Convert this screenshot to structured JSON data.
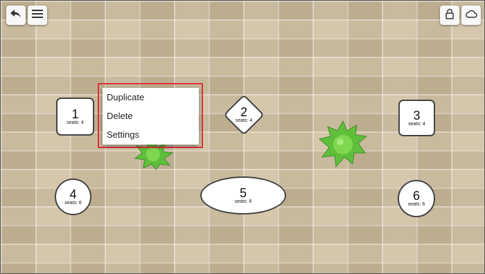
{
  "toolbar": {
    "back_icon": "undo-arrow-icon",
    "menu_icon": "hamburger-menu-icon",
    "lock_icon": "lock-icon",
    "cloud_icon": "cloud-icon"
  },
  "tables": [
    {
      "number": "1",
      "seats": "seats: 4",
      "shape": "rectangle"
    },
    {
      "number": "2",
      "seats": "seats: 4",
      "shape": "diamond"
    },
    {
      "number": "3",
      "seats": "seats: 4",
      "shape": "rectangle"
    },
    {
      "number": "4",
      "seats": "seats: 6",
      "shape": "circle"
    },
    {
      "number": "5",
      "seats": "seats: 6",
      "shape": "ellipse"
    },
    {
      "number": "6",
      "seats": "seats: 6",
      "shape": "circle"
    }
  ],
  "context_menu": {
    "items": [
      "Duplicate",
      "Delete",
      "Settings"
    ],
    "highlight_color": "#e0313a"
  },
  "decor": {
    "plant_icon": "plant-icon",
    "plant_color": "#5fbf3a"
  }
}
